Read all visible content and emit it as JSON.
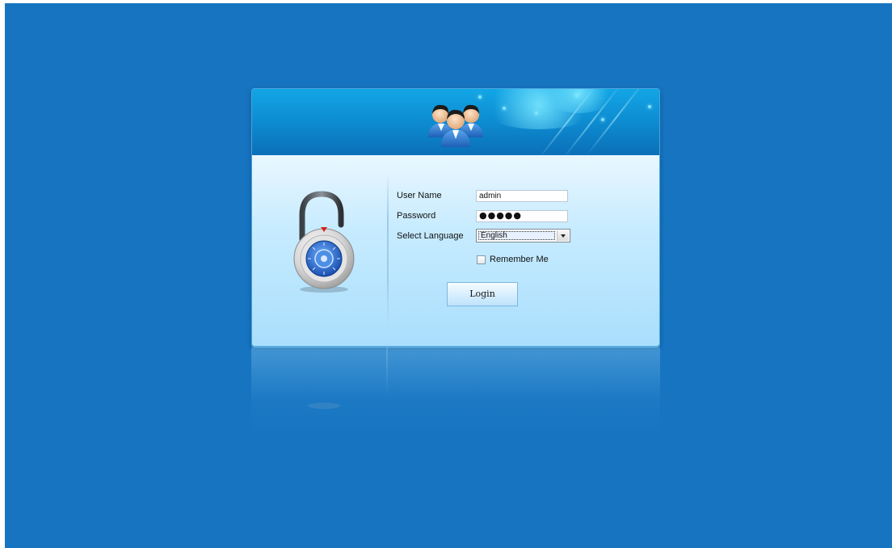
{
  "colors": {
    "background": "#1674c1",
    "header_gradient_top": "#12a6e6",
    "header_gradient_bottom": "#0a6fb8",
    "body_gradient_top": "#e9f7ff",
    "body_gradient_bottom": "#a9defc"
  },
  "header": {
    "icon": "users-icon"
  },
  "side": {
    "icon": "padlock-icon"
  },
  "form": {
    "username_label": "User Name",
    "username_value": "admin",
    "password_label": "Password",
    "password_value": "●●●●●",
    "language_label": "Select Language",
    "language_value": "English",
    "remember_label": "Remember Me",
    "remember_checked": false,
    "login_label": "Login"
  }
}
